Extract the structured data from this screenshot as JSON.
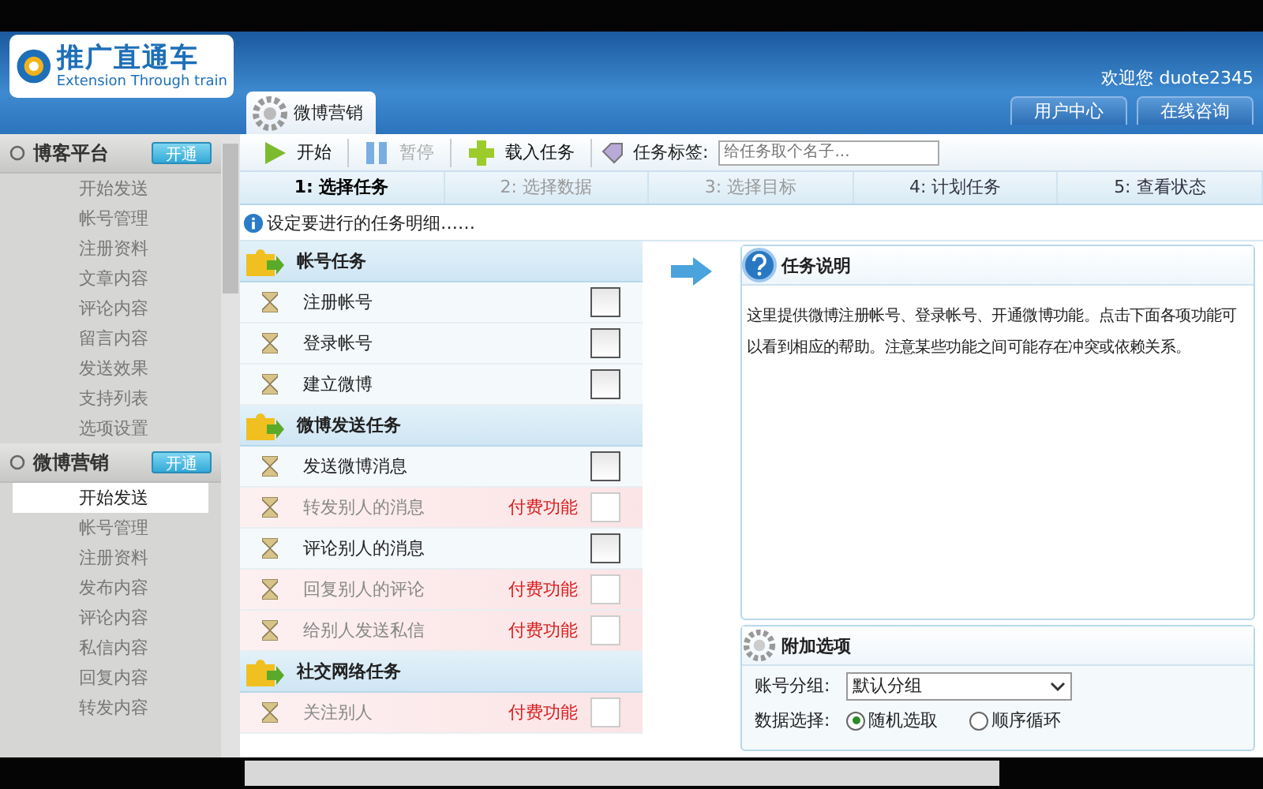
{
  "header": {
    "logo_title": "推广直通车",
    "logo_subtitle": "Extension Through train",
    "welcome": "欢迎您 duote2345",
    "buttons": [
      "用户中心",
      "在线咨询"
    ],
    "tab": "微博营销"
  },
  "sidebar": {
    "groups": [
      {
        "title": "博客平台",
        "action": "开通",
        "items": [
          {
            "label": "开始发送",
            "selected": false
          },
          {
            "label": "帐号管理",
            "selected": false
          },
          {
            "label": "注册资料",
            "selected": false
          },
          {
            "label": "文章内容",
            "selected": false
          },
          {
            "label": "评论内容",
            "selected": false
          },
          {
            "label": "留言内容",
            "selected": false
          },
          {
            "label": "发送效果",
            "selected": false
          },
          {
            "label": "支持列表",
            "selected": false
          },
          {
            "label": "选项设置",
            "selected": false
          }
        ]
      },
      {
        "title": "微博营销",
        "action": "开通",
        "items": [
          {
            "label": "开始发送",
            "selected": true
          },
          {
            "label": "帐号管理",
            "selected": false
          },
          {
            "label": "注册资料",
            "selected": false
          },
          {
            "label": "发布内容",
            "selected": false
          },
          {
            "label": "评论内容",
            "selected": false
          },
          {
            "label": "私信内容",
            "selected": false
          },
          {
            "label": "回复内容",
            "selected": false
          },
          {
            "label": "转发内容",
            "selected": false
          }
        ]
      }
    ]
  },
  "toolbar": {
    "buttons": [
      {
        "kind": "play",
        "label": "开始",
        "disabled": false
      },
      {
        "kind": "pause",
        "label": "暂停",
        "disabled": true
      },
      {
        "kind": "add",
        "label": "载入任务",
        "disabled": false
      }
    ],
    "tag_label": "任务标签:",
    "tag_placeholder": "给任务取个名子..."
  },
  "steps": [
    {
      "label": "1: 选择任务",
      "selected": true,
      "disabled": false
    },
    {
      "label": "2: 选择数据",
      "selected": false,
      "disabled": true
    },
    {
      "label": "3: 选择目标",
      "selected": false,
      "disabled": true
    },
    {
      "label": "4: 计划任务",
      "selected": false,
      "disabled": false
    },
    {
      "label": "5: 查看状态",
      "selected": false,
      "disabled": false
    }
  ],
  "hint": "设定要进行的任务明细……",
  "task_groups": [
    {
      "title": "帐号任务",
      "tasks": [
        {
          "label": "注册帐号",
          "paid": false,
          "checked": false
        },
        {
          "label": "登录帐号",
          "paid": false,
          "checked": false
        },
        {
          "label": "建立微博",
          "paid": false,
          "checked": false
        }
      ]
    },
    {
      "title": "微博发送任务",
      "tasks": [
        {
          "label": "发送微博消息",
          "paid": false,
          "checked": false
        },
        {
          "label": "转发别人的消息",
          "paid": true,
          "paid_label": "付费功能",
          "checked": false
        },
        {
          "label": "评论别人的消息",
          "paid": false,
          "checked": false
        },
        {
          "label": "回复别人的评论",
          "paid": true,
          "paid_label": "付费功能",
          "checked": false
        },
        {
          "label": "给别人发送私信",
          "paid": true,
          "paid_label": "付费功能",
          "checked": false
        }
      ]
    },
    {
      "title": "社交网络任务",
      "tasks": [
        {
          "label": "关注别人",
          "paid": true,
          "paid_label": "付费功能",
          "checked": false
        }
      ]
    }
  ],
  "description": {
    "title": "任务说明",
    "text": "这里提供微博注册帐号、登录帐号、开通微博功能。点击下面各项功能可以看到相应的帮助。注意某些功能之间可能存在冲突或依赖关系。"
  },
  "options": {
    "title": "附加选项",
    "group_label": "账号分组:",
    "group_value": "默认分组",
    "data_label": "数据选择:",
    "radios": [
      {
        "label": "随机选取",
        "selected": true
      },
      {
        "label": "顺序循环",
        "selected": false
      }
    ]
  }
}
